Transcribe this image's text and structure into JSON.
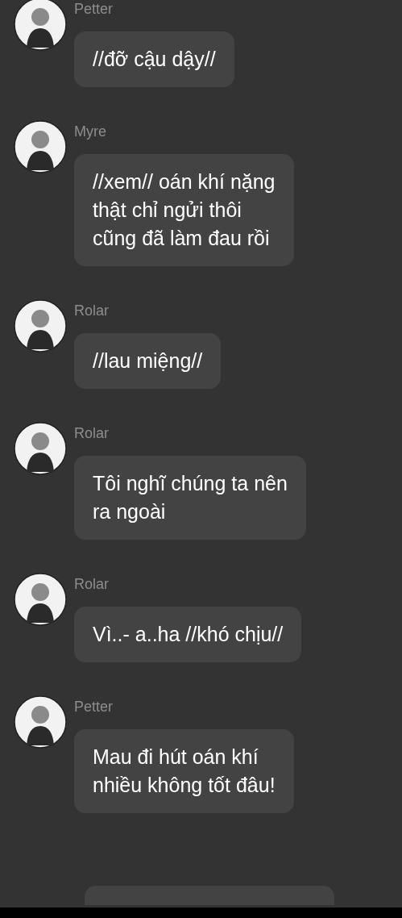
{
  "messages": [
    {
      "sender": "Petter",
      "text": "//đỡ cậu dậy//"
    },
    {
      "sender": "Myre",
      "text": "//xem// oán khí nặng\nthật chỉ ngửi thôi\ncũng đã làm đau rồi"
    },
    {
      "sender": "Rolar",
      "text": "//lau miệng//"
    },
    {
      "sender": "Rolar",
      "text": "Tôi nghĩ chúng ta nên\nra ngoài"
    },
    {
      "sender": "Rolar",
      "text": "Vì..- a..ha //khó chịu//"
    },
    {
      "sender": "Petter",
      "text": "Mau đi hút oán khí\nnhiều không tốt đâu!"
    }
  ]
}
